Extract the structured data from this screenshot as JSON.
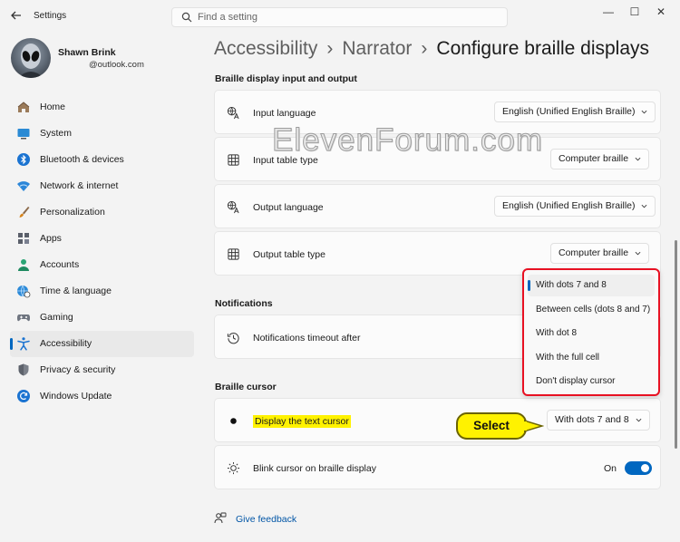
{
  "window": {
    "app_title": "Settings",
    "minimize": "—",
    "maximize": "☐",
    "close": "✕"
  },
  "search": {
    "placeholder": "Find a setting"
  },
  "user": {
    "name": "Shawn Brink",
    "email": "@outlook.com"
  },
  "nav": {
    "items": [
      {
        "label": "Home",
        "icon": "home-icon"
      },
      {
        "label": "System",
        "icon": "system-icon"
      },
      {
        "label": "Bluetooth & devices",
        "icon": "bluetooth-icon"
      },
      {
        "label": "Network & internet",
        "icon": "network-icon"
      },
      {
        "label": "Personalization",
        "icon": "brush-icon"
      },
      {
        "label": "Apps",
        "icon": "apps-icon"
      },
      {
        "label": "Accounts",
        "icon": "accounts-icon"
      },
      {
        "label": "Time & language",
        "icon": "globe-clock-icon"
      },
      {
        "label": "Gaming",
        "icon": "controller-icon"
      },
      {
        "label": "Accessibility",
        "icon": "accessibility-icon"
      },
      {
        "label": "Privacy & security",
        "icon": "shield-icon"
      },
      {
        "label": "Windows Update",
        "icon": "update-icon"
      }
    ],
    "active": "Accessibility"
  },
  "breadcrumb": {
    "part1": "Accessibility",
    "part2": "Narrator",
    "current": "Configure braille displays",
    "sep": "›"
  },
  "sections": {
    "io": "Braille display input and output",
    "notifications": "Notifications",
    "cursor": "Braille cursor"
  },
  "rows": {
    "input_language": {
      "label": "Input language",
      "value": "English (Unified English Braille)"
    },
    "input_table": {
      "label": "Input table type",
      "value": "Computer braille"
    },
    "output_language": {
      "label": "Output language",
      "value": "English (Unified English Braille)"
    },
    "output_table": {
      "label": "Output table type",
      "value": "Computer braille"
    },
    "notifications_timeout": {
      "label": "Notifications timeout after"
    },
    "display_cursor": {
      "label": "Display the text cursor",
      "value": "With dots 7 and 8"
    },
    "blink_cursor": {
      "label": "Blink cursor on braille display",
      "state": "On"
    }
  },
  "menu": {
    "options": [
      "With dots 7 and 8",
      "Between cells (dots 8 and 7)",
      "With dot 8",
      "With the full cell",
      "Don't display cursor"
    ],
    "selected": "With dots 7 and 8"
  },
  "callout": "Select",
  "feedback": "Give feedback",
  "watermark": "ElevenForum.com",
  "colors": {
    "accent": "#0067c0",
    "highlight": "#fff200",
    "annotation_red": "#e81123"
  }
}
